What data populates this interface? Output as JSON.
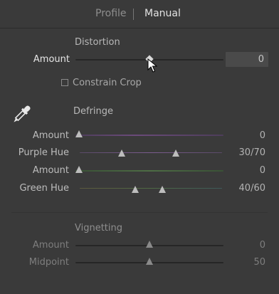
{
  "tabs": [
    {
      "label": "Profile",
      "active": false
    },
    {
      "label": "Manual",
      "active": true
    }
  ],
  "distortion": {
    "title": "Distortion",
    "amount_label": "Amount",
    "amount_value": "0",
    "amount_level": 0.5
  },
  "constrain_crop": {
    "label": "Constrain Crop",
    "checked": false
  },
  "defringe": {
    "title": "Defringe",
    "purple_amount_label": "Amount",
    "purple_amount_value": "0",
    "purple_amount_level": 0,
    "purple_hue_label": "Purple Hue",
    "purple_hue_value": "30/70",
    "purple_hue_range": [
      30,
      70
    ],
    "green_amount_label": "Amount",
    "green_amount_value": "0",
    "green_amount_level": 0,
    "green_hue_label": "Green Hue",
    "green_hue_value": "40/60",
    "green_hue_range": [
      40,
      60
    ]
  },
  "vignetting": {
    "title": "Vignetting",
    "amount_label": "Amount",
    "amount_value": "0",
    "amount_level": 0.5,
    "midpoint_label": "Midpoint",
    "midpoint_value": "50",
    "midpoint_level": 0.5
  },
  "icons": {
    "eyedropper": "eyedropper-icon",
    "cursor": "mouse-pointer-icon"
  }
}
